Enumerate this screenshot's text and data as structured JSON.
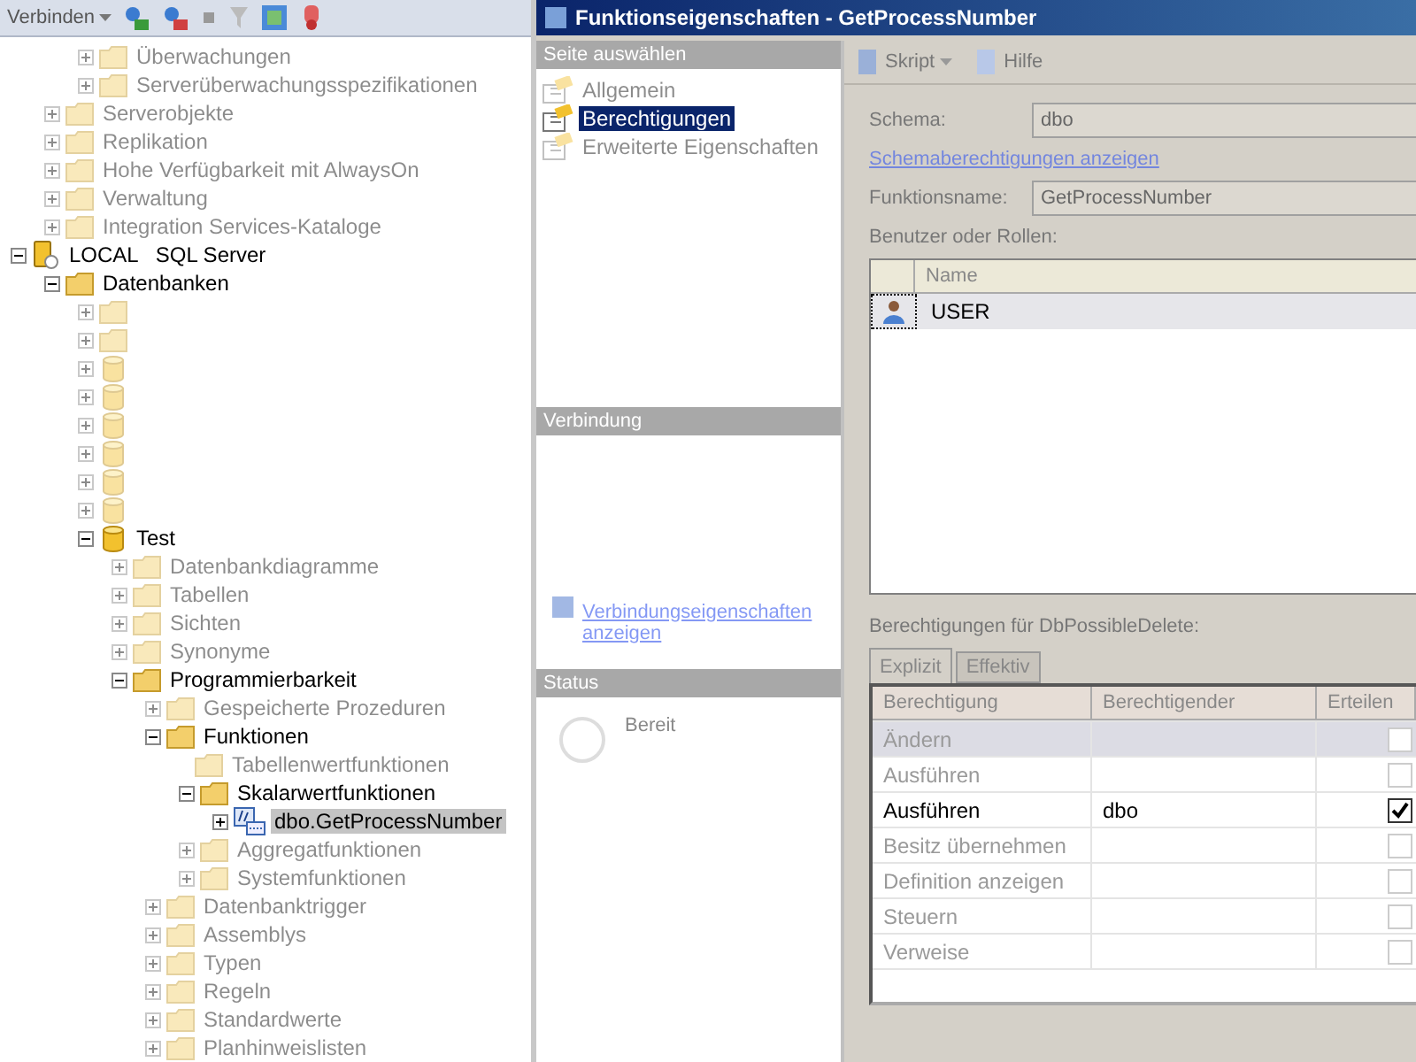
{
  "explorer_toolbar": {
    "connect_label": "Verbinden"
  },
  "tree": [
    {
      "kind": "offscreen",
      "children": [
        {
          "kind": "offscreen",
          "children": [
            {
              "kind": "folder",
              "label": "Überwachungen",
              "dimmed": true,
              "expanded": false,
              "selected": false
            },
            {
              "kind": "folder",
              "label": "Serverüberwachungsspezifikationen",
              "dimmed": true,
              "expanded": false,
              "selected": false
            }
          ]
        },
        {
          "kind": "folder",
          "label": "Serverobjekte",
          "dimmed": true,
          "expanded": false,
          "selected": false
        },
        {
          "kind": "folder",
          "label": "Replikation",
          "dimmed": true,
          "expanded": false,
          "selected": false
        },
        {
          "kind": "folder",
          "label": "Hohe Verfügbarkeit mit AlwaysOn",
          "dimmed": true,
          "expanded": false,
          "selected": false
        },
        {
          "kind": "folder",
          "label": "Verwaltung",
          "dimmed": true,
          "expanded": false,
          "selected": false
        },
        {
          "kind": "folder",
          "label": "Integration Services-Kataloge",
          "dimmed": true,
          "expanded": false,
          "selected": false
        }
      ]
    },
    {
      "kind": "server",
      "label": "LOCAL   SQL Server",
      "dimmed": false,
      "expanded": true,
      "selected": false,
      "children": [
        {
          "kind": "folder",
          "label": "Datenbanken",
          "dimmed": false,
          "expanded": true,
          "selected": false,
          "children": [
            {
              "kind": "folder",
              "dimmed": true,
              "expanded": false,
              "selected": false
            },
            {
              "kind": "folder",
              "dimmed": true,
              "expanded": false,
              "selected": false
            },
            {
              "kind": "database",
              "dimmed": true,
              "expanded": false,
              "selected": false
            },
            {
              "kind": "database",
              "dimmed": true,
              "expanded": false,
              "selected": false
            },
            {
              "kind": "database",
              "dimmed": true,
              "expanded": false,
              "selected": false
            },
            {
              "kind": "database",
              "dimmed": true,
              "expanded": false,
              "selected": false
            },
            {
              "kind": "database",
              "dimmed": true,
              "expanded": false,
              "selected": false
            },
            {
              "kind": "database",
              "dimmed": true,
              "expanded": false,
              "selected": false
            },
            {
              "kind": "database",
              "label": "Test",
              "dimmed": false,
              "expanded": true,
              "selected": false,
              "children": [
                {
                  "kind": "folder",
                  "label": "Datenbankdiagramme",
                  "dimmed": true,
                  "expanded": false,
                  "selected": false
                },
                {
                  "kind": "folder",
                  "label": "Tabellen",
                  "dimmed": true,
                  "expanded": false,
                  "selected": false
                },
                {
                  "kind": "folder",
                  "label": "Sichten",
                  "dimmed": true,
                  "expanded": false,
                  "selected": false
                },
                {
                  "kind": "folder",
                  "label": "Synonyme",
                  "dimmed": true,
                  "expanded": false,
                  "selected": false
                },
                {
                  "kind": "folder",
                  "label": "Programmierbarkeit",
                  "dimmed": false,
                  "expanded": true,
                  "selected": false,
                  "children": [
                    {
                      "kind": "folder",
                      "label": "Gespeicherte Prozeduren",
                      "dimmed": true,
                      "expanded": false,
                      "selected": false
                    },
                    {
                      "kind": "folder",
                      "label": "Funktionen",
                      "dimmed": false,
                      "expanded": true,
                      "selected": false,
                      "children": [
                        {
                          "kind": "empty-folder",
                          "label": "Tabellenwertfunktionen",
                          "dimmed": true,
                          "selected": false
                        },
                        {
                          "kind": "folder",
                          "label": "Skalarwertfunktionen",
                          "dimmed": false,
                          "expanded": true,
                          "selected": false,
                          "children": [
                            {
                              "kind": "function",
                              "label": "dbo.GetProcessNumber",
                              "dimmed": false,
                              "expanded": false,
                              "selected": true
                            }
                          ]
                        },
                        {
                          "kind": "folder",
                          "label": "Aggregatfunktionen",
                          "dimmed": true,
                          "expanded": false,
                          "selected": false
                        },
                        {
                          "kind": "folder",
                          "label": "Systemfunktionen",
                          "dimmed": true,
                          "expanded": false,
                          "selected": false
                        }
                      ]
                    },
                    {
                      "kind": "folder",
                      "label": "Datenbanktrigger",
                      "dimmed": true,
                      "expanded": false,
                      "selected": false
                    },
                    {
                      "kind": "folder",
                      "label": "Assemblys",
                      "dimmed": true,
                      "expanded": false,
                      "selected": false
                    },
                    {
                      "kind": "folder",
                      "label": "Typen",
                      "dimmed": true,
                      "expanded": false,
                      "selected": false
                    },
                    {
                      "kind": "folder",
                      "label": "Regeln",
                      "dimmed": true,
                      "expanded": false,
                      "selected": false
                    },
                    {
                      "kind": "folder",
                      "label": "Standardwerte",
                      "dimmed": true,
                      "expanded": false,
                      "selected": false
                    },
                    {
                      "kind": "folder",
                      "label": "Planhinweislisten",
                      "dimmed": true,
                      "expanded": false,
                      "selected": false
                    }
                  ]
                }
              ]
            }
          ]
        }
      ]
    }
  ],
  "dialog": {
    "title": "Funktionseigenschaften - GetProcessNumber",
    "page_header": "Seite auswählen",
    "pages": [
      {
        "label": "Allgemein",
        "selected": false,
        "dimmed": true
      },
      {
        "label": "Berechtigungen",
        "selected": true,
        "dimmed": false
      },
      {
        "label": "Erweiterte Eigenschaften",
        "selected": false,
        "dimmed": true
      }
    ],
    "connection_header": "Verbindung",
    "connection_link": "Verbindungseigenschaften anzeigen",
    "status_header": "Status",
    "status": "Bereit",
    "toolbar": {
      "script": "Skript",
      "help": "Hilfe"
    },
    "schema_label": "Schema:",
    "schema_value": "dbo",
    "schema_link": "Schemaberechtigungen anzeigen",
    "function_label": "Funktionsname:",
    "function_value": "GetProcessNumber",
    "users_label": "Benutzer oder Rollen:",
    "users_column": "Name",
    "users": [
      {
        "name": "USER",
        "selected": true
      }
    ],
    "permissions_label": "Berechtigungen für DbPossibleDelete:",
    "tabs": [
      {
        "label": "Explizit",
        "selected": true
      },
      {
        "label": "Effektiv",
        "selected": false
      }
    ],
    "permission_columns": [
      "Berechtigung",
      "Berechtigender",
      "Erteilen"
    ],
    "permissions": [
      {
        "permission": "Ändern",
        "granted": false,
        "dimmed": true,
        "selected": true
      },
      {
        "permission": "Ausführen",
        "granted": false,
        "dimmed": true,
        "selected": false
      },
      {
        "permission": "Ausführen",
        "grantor": "dbo",
        "granted": true,
        "dimmed": false,
        "selected": false
      },
      {
        "permission": "Besitz übernehmen",
        "granted": false,
        "dimmed": true,
        "selected": false
      },
      {
        "permission": "Definition anzeigen",
        "granted": false,
        "dimmed": true,
        "selected": false
      },
      {
        "permission": "Steuern",
        "granted": false,
        "dimmed": true,
        "selected": false
      },
      {
        "permission": "Verweise",
        "granted": false,
        "dimmed": true,
        "selected": false
      }
    ]
  }
}
